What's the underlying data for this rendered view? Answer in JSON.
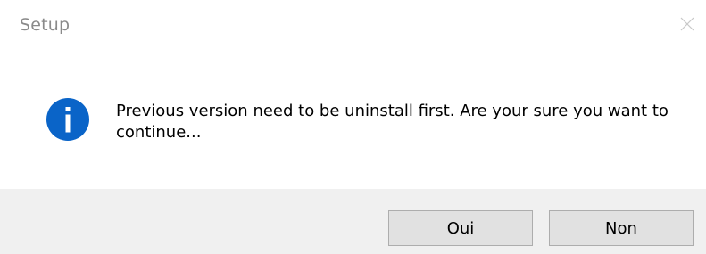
{
  "window": {
    "title": "Setup",
    "close_icon": "close-icon"
  },
  "message": {
    "icon": "info-icon",
    "text": "Previous version need to be uninstall first. Are your sure you want to continue..."
  },
  "buttons": {
    "yes_label": "Oui",
    "no_label": "Non"
  },
  "colors": {
    "info_icon": "#0a64c8",
    "footer_bg": "#f0f0f0",
    "button_bg": "#e1e1e1",
    "button_border": "#adadad",
    "title_text": "#8a8a8a"
  }
}
